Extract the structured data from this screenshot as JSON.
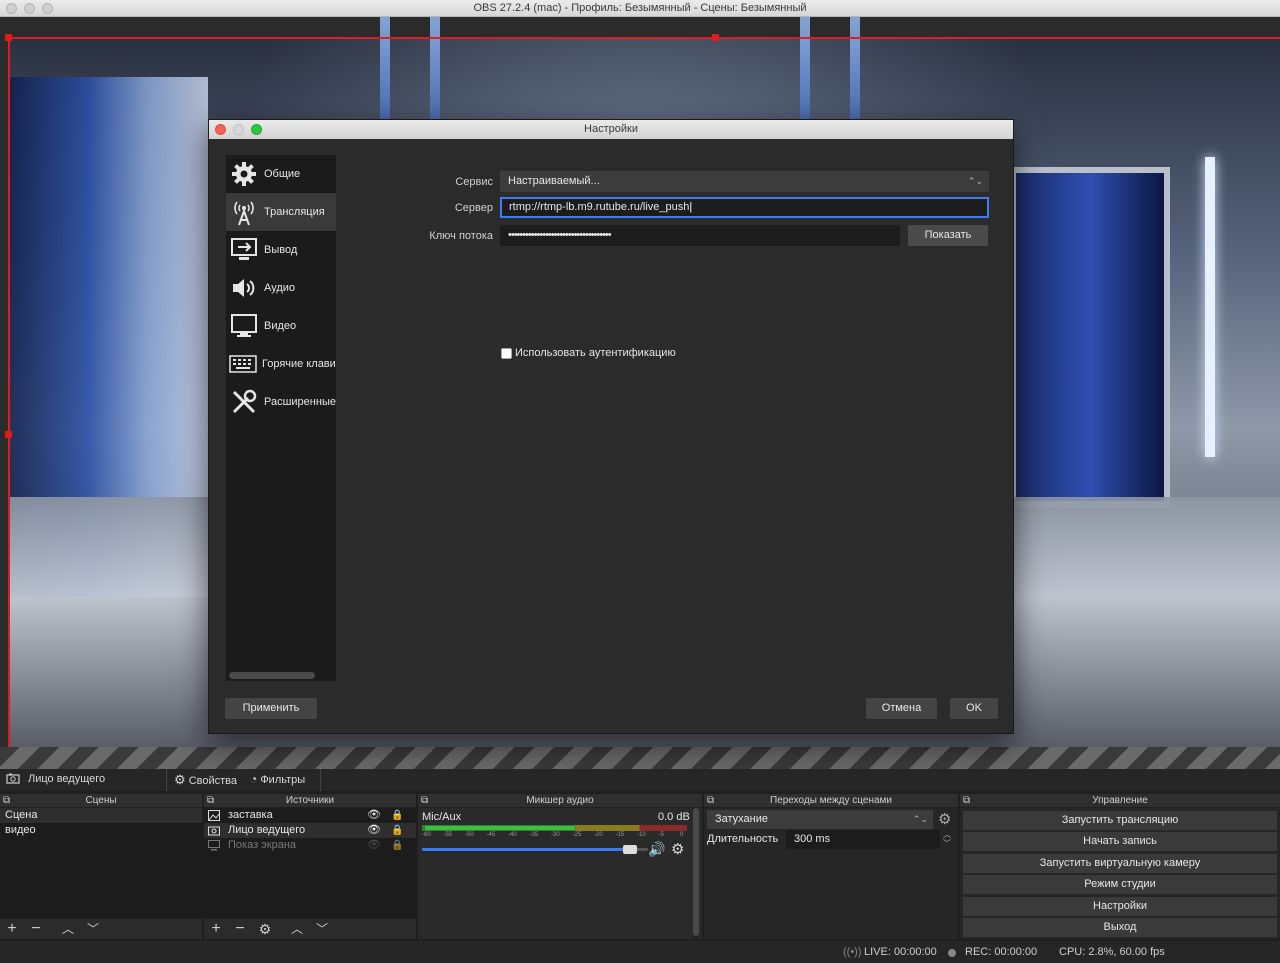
{
  "window": {
    "title": "OBS 27.2.4 (mac) - Профиль: Безымянный - Сцены: Безымянный"
  },
  "settings": {
    "title": "Настройки",
    "nav": [
      {
        "label": "Общие",
        "icon": "gear-icon"
      },
      {
        "label": "Трансляция",
        "icon": "broadcast-icon"
      },
      {
        "label": "Вывод",
        "icon": "output-icon"
      },
      {
        "label": "Аудио",
        "icon": "speaker-icon"
      },
      {
        "label": "Видео",
        "icon": "monitor-icon"
      },
      {
        "label": "Горячие клавиши",
        "icon": "keyboard-icon"
      },
      {
        "label": "Расширенные",
        "icon": "tools-icon"
      }
    ],
    "service_label": "Сервис",
    "service_value": "Настраиваемый...",
    "server_label": "Сервер",
    "server_value": "rtmp://rtmp-lb.m9.rutube.ru/live_push",
    "key_label": "Ключ потока",
    "key_value": "••••••••••••••••••••••••••••••••••••",
    "show_button": "Показать",
    "auth_label": "Использовать аутентификацию",
    "apply_button": "Применить",
    "cancel_button": "Отмена",
    "ok_button": "OK"
  },
  "source_bar": {
    "current_source": "Лицо ведущего",
    "properties": "Свойства",
    "filters": "Фильтры"
  },
  "docks": {
    "scenes": {
      "title": "Сцены",
      "items": [
        "Сцена",
        "видео"
      ]
    },
    "sources": {
      "title": "Источники",
      "items": [
        {
          "label": "заставка",
          "icon": "image-icon",
          "visible": true
        },
        {
          "label": "Лицо ведущего",
          "icon": "camera-icon",
          "visible": true
        },
        {
          "label": "Показ экрана",
          "icon": "display-icon",
          "visible": false
        }
      ]
    },
    "mixer": {
      "title": "Микшер аудио",
      "channel": "Mic/Aux",
      "level": "0.0 dB",
      "ticks": [
        "-60",
        "-55",
        "-50",
        "-45",
        "-40",
        "-35",
        "-30",
        "-25",
        "-20",
        "-15",
        "-10",
        "-5",
        "0"
      ],
      "volume_fraction": 0.95
    },
    "transitions": {
      "title": "Переходы между сценами",
      "type": "Затухание",
      "duration_label": "Длительность",
      "duration_value": "300 ms"
    },
    "controls": {
      "title": "Управление",
      "buttons": [
        "Запустить трансляцию",
        "Начать запись",
        "Запустить виртуальную камеру",
        "Режим студии",
        "Настройки",
        "Выход"
      ]
    }
  },
  "status": {
    "live": "LIVE: 00:00:00",
    "rec": "REC: 00:00:00",
    "cpu": "CPU: 2.8%, 60.00 fps"
  },
  "colors": {
    "selection": "#e21b1b",
    "focus": "#3b7cf0",
    "meter_green": "#3fbf3f"
  }
}
